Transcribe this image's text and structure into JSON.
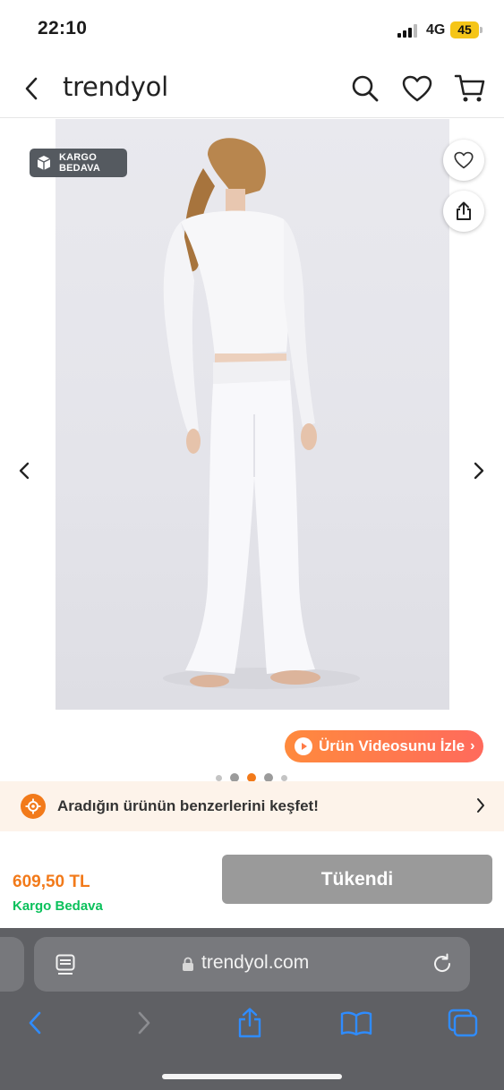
{
  "status_bar": {
    "time": "22:10",
    "network": "4G",
    "battery": "45"
  },
  "header": {
    "logo": "trendyol",
    "icons": [
      "back-icon",
      "search-icon",
      "heart-icon",
      "cart-icon"
    ]
  },
  "gallery": {
    "badge": {
      "line1": "KARGO",
      "line2": "BEDAVA"
    },
    "video_button": "Ürün Videosunu İzle",
    "video_chevron": "›",
    "page_count": 5,
    "active_page": 3,
    "colors": {
      "accent": "#f27a1a",
      "video_gradient_start": "#ff8a3d",
      "video_gradient_end": "#ff6a5c"
    }
  },
  "similar_banner": {
    "text": "Aradığın ürünün benzerlerini keşfet!"
  },
  "buy_box": {
    "price": "609,50 TL",
    "shipping": "Kargo Bedava",
    "button": "Tükendi",
    "colors": {
      "price": "#f27a1a",
      "shipping": "#0bc15c",
      "button_bg": "#9a9a9a"
    }
  },
  "browser": {
    "url": "trendyol.com",
    "toolbar_icons": [
      "back-arrow-icon",
      "forward-arrow-icon",
      "share-icon",
      "bookmarks-icon",
      "tabs-icon"
    ]
  }
}
